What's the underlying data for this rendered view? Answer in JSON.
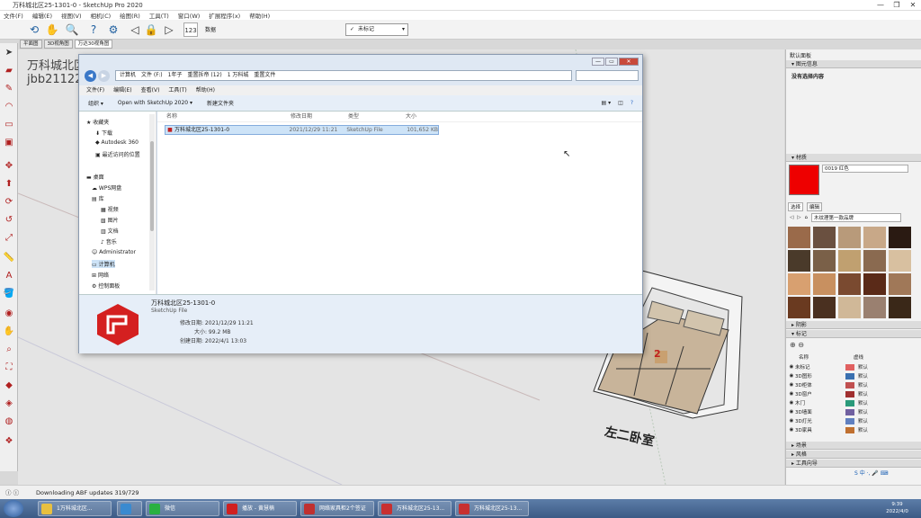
{
  "window": {
    "title": "万科城北区25-1301-0 - SketchUp Pro 2020",
    "min": "—",
    "max": "❐",
    "close": "✕"
  },
  "menu": [
    "文件(F)",
    "编辑(E)",
    "视图(V)",
    "相机(C)",
    "绘图(R)",
    "工具(T)",
    "窗口(W)",
    "扩展程序(x)",
    "帮助(H)"
  ],
  "toolbar": {
    "number_label": "123",
    "unit_label": "数据",
    "layer_select": "未标记",
    "check": "✓"
  },
  "tabs": [
    "平面图",
    "3D视角图",
    "万达30视角图"
  ],
  "viewport": {
    "line1": "万科城北区",
    "line2": "jbb211228",
    "room_label": "左二卧室",
    "marker": "2"
  },
  "status": {
    "text": "Downloading ABF updates 319/729"
  },
  "explorer": {
    "address": [
      "计算机",
      "文件 (F:)",
      "1年子",
      "重置拆帝 (12)",
      "1 万科城",
      "重置文件"
    ],
    "menu": [
      "文件(F)",
      "编辑(E)",
      "查看(V)",
      "工具(T)",
      "帮助(H)"
    ],
    "cmd": {
      "organize": "组织 ▾",
      "open_with": "Open with SketchUp 2020 ▾",
      "new_folder": "新建文件夹"
    },
    "nav": {
      "favorites": "收藏夹",
      "downloads": "下载",
      "autodesk": "Autodesk 360",
      "recent": "最近访问的位置",
      "desktop": "桌面",
      "wps": "WPS网盘",
      "library": "库",
      "videos": "视频",
      "pictures": "图片",
      "docs": "文档",
      "music": "音乐",
      "admin": "Administrator",
      "computer": "计算机",
      "network": "网络",
      "control": "控制面板"
    },
    "columns": {
      "name": "名称",
      "date": "修改日期",
      "type": "类型",
      "size": "大小"
    },
    "file": {
      "name": "万科城北区25-1301-0",
      "date": "2021/12/29 11:21",
      "type": "SketchUp File",
      "size": "101,652 KB"
    },
    "details": {
      "name": "万科城北区25-1301-0",
      "type": "SketchUp File",
      "modified": "修改日期: 2021/12/29 11:21",
      "size": "大小: 99.2 MB",
      "created": "创建日期: 2022/4/1 13:03"
    }
  },
  "right_panel": {
    "tray_title": "默认面板",
    "entity_header": "▾ 图元信息",
    "entity_value": "没有选择内容",
    "materials_header": "▾ 材质",
    "material_name": "0019 红色",
    "material_color": "#ee0000",
    "mat_tabs": [
      "选择",
      "编辑"
    ],
    "mat_folder": "木纹理第一款品牌",
    "shadows_header": "▸ 阴影",
    "tags_header": "▾ 标记",
    "tag_cols": {
      "name": "名称",
      "dash": "虚线"
    },
    "tags": [
      {
        "name": "未标记",
        "dash": "默认",
        "color": "#e06060"
      },
      {
        "name": "3D图形",
        "dash": "默认",
        "color": "#3a70b0"
      },
      {
        "name": "3D柜体",
        "dash": "默认",
        "color": "#c05050"
      },
      {
        "name": "3D窗户",
        "dash": "默认",
        "color": "#a03030"
      },
      {
        "name": "木门",
        "dash": "默认",
        "color": "#2a9a7a"
      },
      {
        "name": "3D墙面",
        "dash": "默认",
        "color": "#7060a0"
      },
      {
        "name": "3D灯光",
        "dash": "默认",
        "color": "#6080c0"
      },
      {
        "name": "3D家具",
        "dash": "默认",
        "color": "#c07030"
      }
    ],
    "scenes_header": "▸ 场景",
    "styles_header": "▸ 风格",
    "tools_header": "▸ 工具向导",
    "ime": "S 中 ·, 🎤 ⌨"
  },
  "taskbar": {
    "tasks": [
      {
        "label": "1万科城北区...",
        "color": "#e8c040"
      },
      {
        "label": "",
        "color": "#3a8ad0"
      },
      {
        "label": "微信",
        "color": "#2ab040"
      },
      {
        "label": "播放 - 黄慧楠",
        "color": "#d02020"
      },
      {
        "label": "网络家具柜2个签证",
        "color": "#c03030"
      },
      {
        "label": "万科城北区25-13...",
        "color": "#c83030"
      },
      {
        "label": "万科城北区25-13...",
        "color": "#c83030"
      }
    ],
    "time": "9:39",
    "date": "2022/4/0"
  }
}
